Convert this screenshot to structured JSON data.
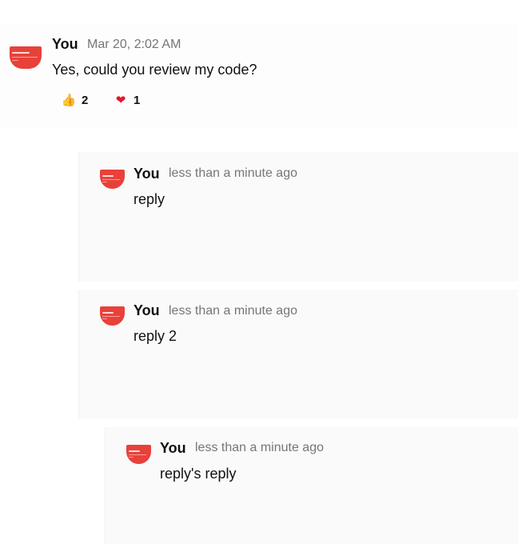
{
  "messages": [
    {
      "author": "You",
      "time": "Mar 20, 2:02 AM",
      "text": "Yes, could you review my code?",
      "reactions": [
        {
          "icon": "thumbs-up-icon",
          "glyph": "👍",
          "count": "2"
        },
        {
          "icon": "heart-icon",
          "glyph": "❤",
          "count": "1"
        }
      ]
    },
    {
      "author": "You",
      "time": "less than a minute ago",
      "text": "reply"
    },
    {
      "author": "You",
      "time": "less than a minute ago",
      "text": "reply 2"
    },
    {
      "author": "You",
      "time": "less than a minute ago",
      "text": "reply's reply"
    }
  ],
  "colors": {
    "avatar": "#e8413a",
    "time_text": "#767676",
    "reply_background": "#fafafa"
  }
}
